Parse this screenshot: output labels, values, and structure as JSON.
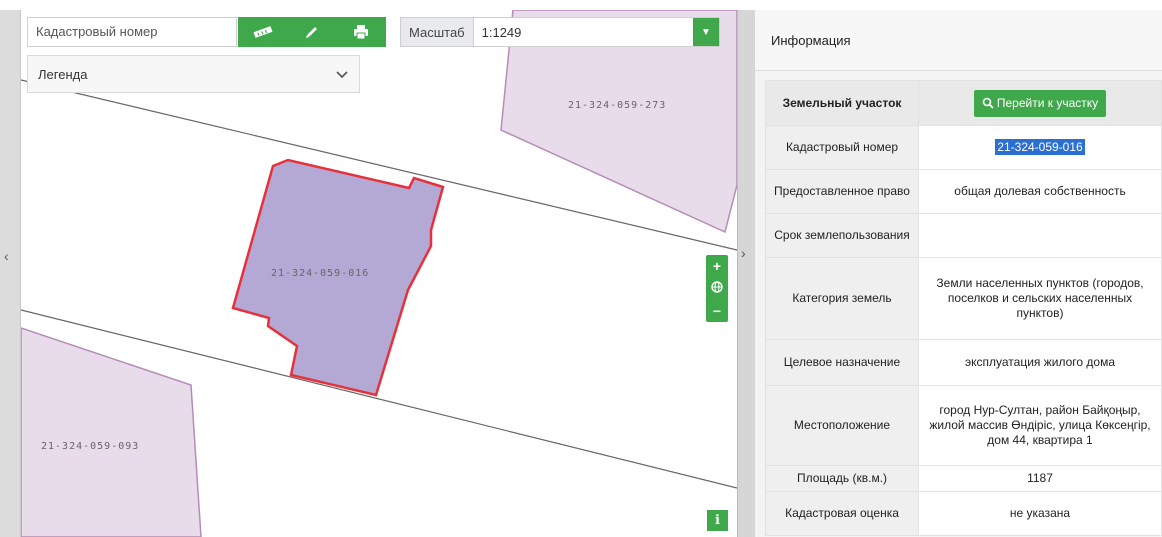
{
  "toolbar": {
    "cadastral_placeholder": "Кадастровый номер",
    "scale_label": "Масштаб",
    "scale_value": "1:1249",
    "tools": [
      "ruler-icon",
      "pencil-icon",
      "print-icon"
    ]
  },
  "legend": {
    "label": "Легенда"
  },
  "map": {
    "parcels": [
      {
        "id": "21-324-059-273"
      },
      {
        "id": "21-324-059-016",
        "highlighted": true
      },
      {
        "id": "21-324-059-093"
      }
    ],
    "zoom": {
      "in": "+",
      "reset": "globe-icon",
      "out": "−"
    },
    "info_button": "i"
  },
  "panel": {
    "title": "Информация",
    "section_title": "Земельный участок",
    "goto_button": "Перейти к участку",
    "rows": [
      {
        "key": "Кадастровый номер",
        "value": "21-324-059-016"
      },
      {
        "key": "Предоставленное право",
        "value": "общая долевая собственность"
      },
      {
        "key": "Срок землепользования",
        "value": ""
      },
      {
        "key": "Категория земель",
        "value": "Земли населенных пунктов (городов, поселков и сельских населенных пунктов)"
      },
      {
        "key": "Целевое назначение",
        "value": "эксплуатация жилого дома"
      },
      {
        "key": "Местоположение",
        "value": "город Нур-Султан, район Байқоңыр, жилой массив Өндіріс, улица Көксеңгір, дом 44, квартира 1"
      },
      {
        "key": "Площадь (кв.м.)",
        "value": "1187"
      },
      {
        "key": "Кадастровая оценка",
        "value": "не указана"
      }
    ]
  },
  "colors": {
    "accent": "#3fa84b",
    "parcel_fill": "#b3a9d4",
    "parcel_stroke": "#e8303a",
    "neighbor_fill": "#e9dcea"
  }
}
